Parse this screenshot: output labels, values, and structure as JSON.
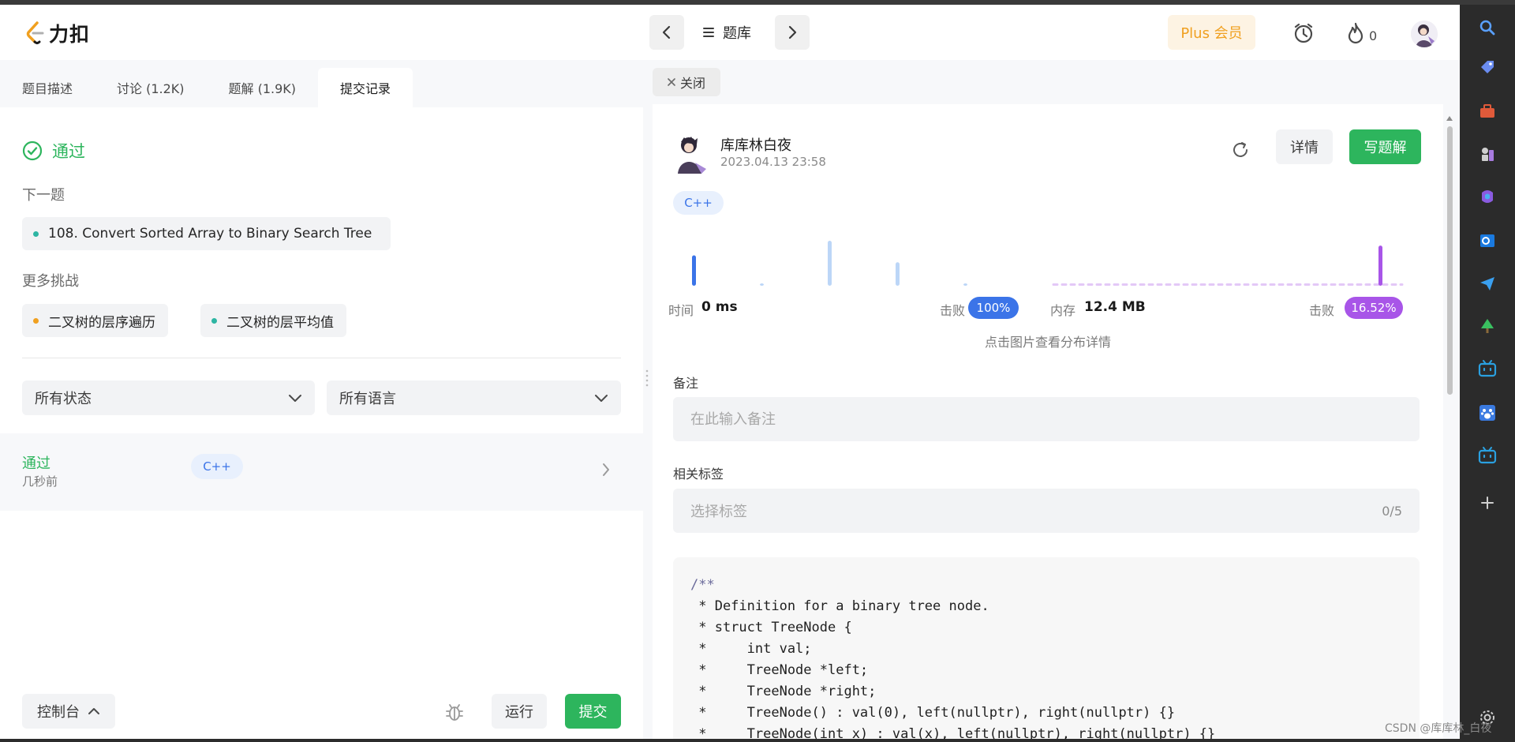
{
  "header": {
    "logo_text": "力扣",
    "problem_bank_label": "题库",
    "plus_label": "Plus 会员",
    "streak_count": "0"
  },
  "left": {
    "tabs": [
      {
        "label": "题目描述",
        "active": false
      },
      {
        "label": "讨论 (1.2K)",
        "active": false
      },
      {
        "label": "题解 (1.9K)",
        "active": false
      },
      {
        "label": "提交记录",
        "active": true
      }
    ],
    "status": "通过",
    "next_label": "下一题",
    "next_problem": "108. Convert Sorted Array to Binary Search Tree",
    "more_label": "更多挑战",
    "challenges": [
      {
        "label": "二叉树的层序遍历",
        "color": "#f0a020"
      },
      {
        "label": "二叉树的层平均值",
        "color": "#2db5a3"
      }
    ],
    "filter_status": "所有状态",
    "filter_language": "所有语言",
    "submission": {
      "status": "通过",
      "time": "几秒前",
      "language": "C++"
    },
    "console_label": "控制台",
    "run_label": "运行",
    "submit_label": "提交"
  },
  "right": {
    "close_label": "关闭",
    "author_name": "库库林白夜",
    "author_date": "2023.04.13 23:58",
    "detail_label": "详情",
    "write_solution_label": "写题解",
    "language": "C++",
    "runtime": {
      "label": "时间",
      "value": "0 ms",
      "beats_label": "击败",
      "beats": "100%"
    },
    "memory": {
      "label": "内存",
      "value": "12.4 MB",
      "beats_label": "击败",
      "beats": "16.52%"
    },
    "chart_hint": "点击图片查看分布详情",
    "notes_label": "备注",
    "notes_placeholder": "在此输入备注",
    "tags_label": "相关标签",
    "tags_placeholder": "选择标签",
    "tags_count": "0/5",
    "code_lines": [
      "/**",
      " * Definition for a binary tree node.",
      " * struct TreeNode {",
      " *     int val;",
      " *     TreeNode *left;",
      " *     TreeNode *right;",
      " *     TreeNode() : val(0), left(nullptr), right(nullptr) {}",
      " *     TreeNode(int x) : val(x), left(nullptr), right(nullptr) {}"
    ]
  },
  "watermark": "CSDN @库库林_白夜",
  "colors": {
    "accent_green": "#2db55d",
    "runtime_blue": "#3b74e8",
    "memory_purple": "#a855e8",
    "plus_orange": "#f0a020"
  },
  "chart_data": {
    "type": "bar",
    "runtime_distribution": {
      "selected_index": 0,
      "values": [
        0.62,
        0.04,
        0.92,
        0.48,
        0.04
      ]
    },
    "memory_distribution": {
      "selected_index": 1,
      "values": [
        0.04,
        0.82
      ]
    }
  }
}
